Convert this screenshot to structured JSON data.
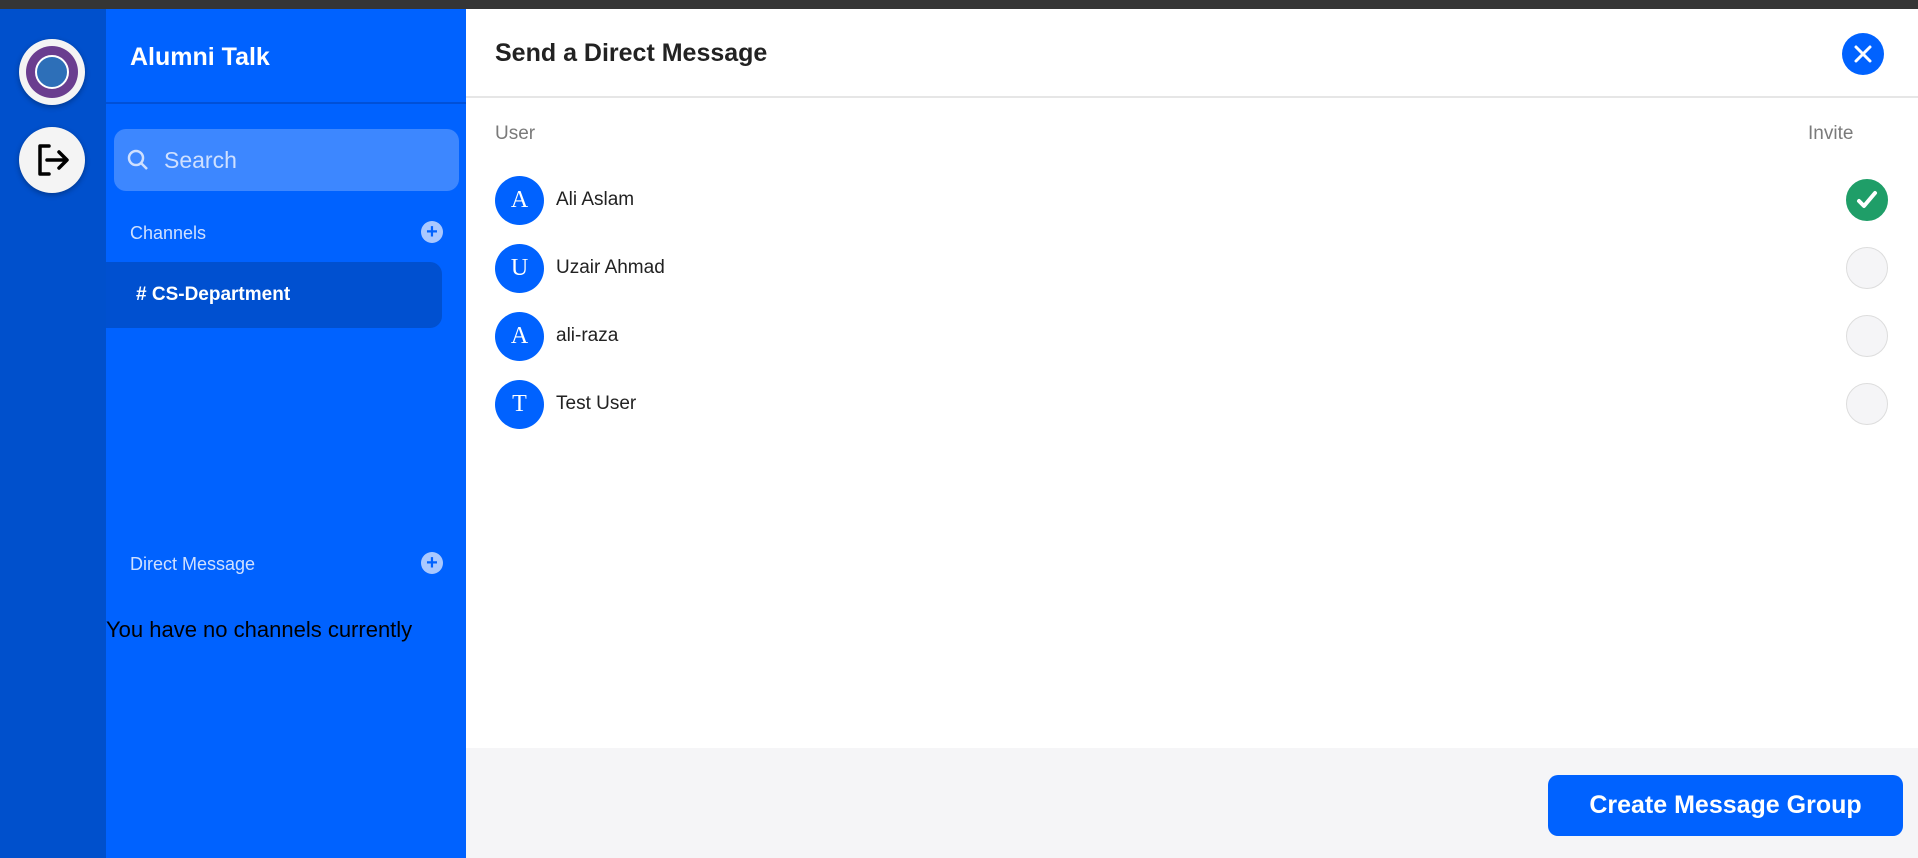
{
  "app": {
    "title": "Alumni Talk"
  },
  "sidebar": {
    "search_placeholder": "Search",
    "channels_label": "Channels",
    "channels": [
      {
        "name": "# CS-Department"
      }
    ],
    "direct_message_label": "Direct Message",
    "empty_message": "You have no channels currently"
  },
  "modal": {
    "title": "Send a Direct Message",
    "col_user": "User",
    "col_invite": "Invite",
    "users": [
      {
        "initial": "A",
        "name": "Ali Aslam",
        "invited": true
      },
      {
        "initial": "U",
        "name": "Uzair Ahmad",
        "invited": false
      },
      {
        "initial": "A",
        "name": "ali-raza",
        "invited": false
      },
      {
        "initial": "T",
        "name": "Test User",
        "invited": false
      }
    ],
    "create_button": "Create Message Group"
  },
  "colors": {
    "primary": "#0062ff",
    "rail": "#0050cc",
    "checked": "#1f9e68"
  }
}
